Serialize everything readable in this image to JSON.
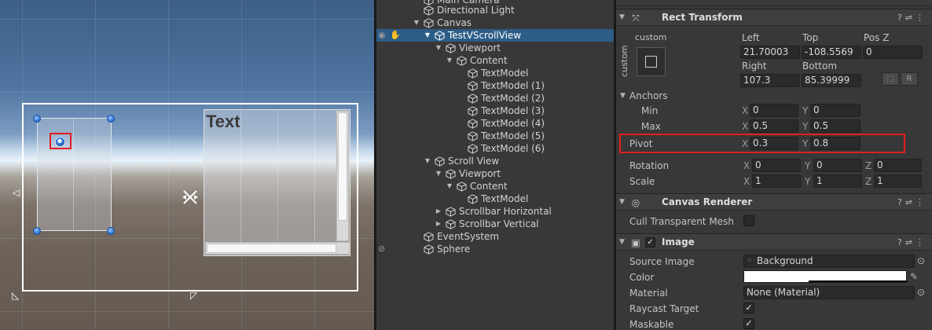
{
  "scene": {
    "text_label": "Text"
  },
  "hierarchy": {
    "items": [
      {
        "label": "Main Camera"
      },
      {
        "label": "Directional Light"
      },
      {
        "label": "Canvas"
      },
      {
        "label": "TestVScrollView"
      },
      {
        "label": "Viewport"
      },
      {
        "label": "Content"
      },
      {
        "label": "TextModel"
      },
      {
        "label": "TextModel (1)"
      },
      {
        "label": "TextModel (2)"
      },
      {
        "label": "TextModel (3)"
      },
      {
        "label": "TextModel (4)"
      },
      {
        "label": "TextModel (5)"
      },
      {
        "label": "TextModel (6)"
      },
      {
        "label": "Scroll View"
      },
      {
        "label": "Viewport"
      },
      {
        "label": "Content"
      },
      {
        "label": "TextModel"
      },
      {
        "label": "Scrollbar Horizontal"
      },
      {
        "label": "Scrollbar Vertical"
      },
      {
        "label": "EventSystem"
      },
      {
        "label": "Sphere"
      }
    ]
  },
  "inspector": {
    "rect_transform": {
      "title": "Rect Transform",
      "anchor_preset_top": "custom",
      "anchor_preset_side": "custom",
      "left_label": "Left",
      "left": "21.70003",
      "top_label": "Top",
      "top": "-108.5569",
      "posz_label": "Pos Z",
      "posz": "0",
      "right_label": "Right",
      "right": "107.3",
      "bottom_label": "Bottom",
      "bottom": "85.39999",
      "raw_button": "R",
      "anchors_label": "Anchors",
      "min_label": "Min",
      "min_x": "0",
      "min_y": "0",
      "max_label": "Max",
      "max_x": "0.5",
      "max_y": "0.5",
      "pivot_label": "Pivot",
      "pivot_x": "0.3",
      "pivot_y": "0.8",
      "rotation_label": "Rotation",
      "rot_x": "0",
      "rot_y": "0",
      "rot_z": "0",
      "scale_label": "Scale",
      "scale_x": "1",
      "scale_y": "1",
      "scale_z": "1",
      "x": "X",
      "y": "Y",
      "z": "Z"
    },
    "canvas_renderer": {
      "title": "Canvas Renderer",
      "cull_label": "Cull Transparent Mesh"
    },
    "image": {
      "title": "Image",
      "source_label": "Source Image",
      "source_value": "Background",
      "color_label": "Color",
      "material_label": "Material",
      "material_value": "None (Material)",
      "raycast_label": "Raycast Target",
      "maskable_label": "Maskable"
    }
  }
}
